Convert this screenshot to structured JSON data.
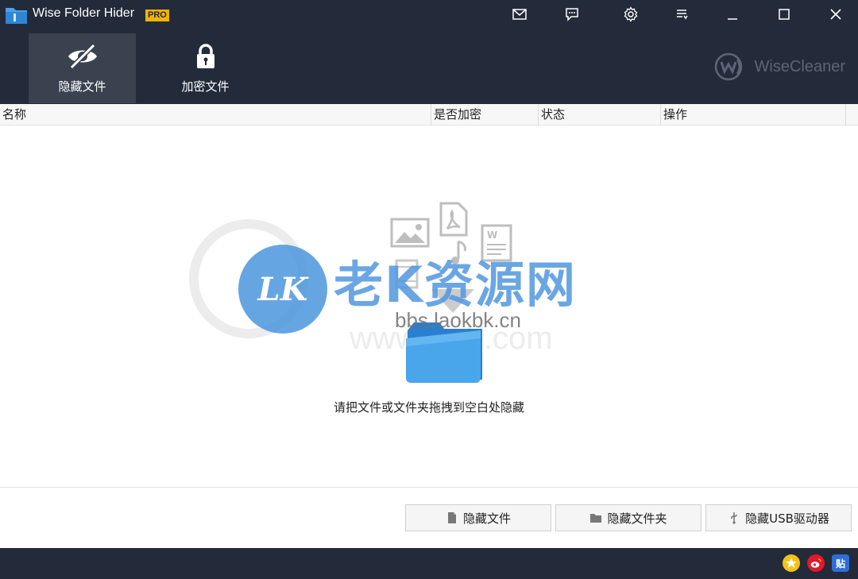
{
  "window": {
    "title": "Wise Folder Hider",
    "badge": "PRO"
  },
  "nav": {
    "tabs": [
      {
        "label": "隐藏文件",
        "icon": "eye-off-icon",
        "active": true
      },
      {
        "label": "加密文件",
        "icon": "lock-icon",
        "active": false
      }
    ],
    "brand": "WiseCleaner"
  },
  "table": {
    "columns": [
      "名称",
      "是否加密",
      "状态",
      "操作"
    ],
    "rows": []
  },
  "drop_zone": {
    "hint": "请把文件或文件夹拖拽到空白处隐藏"
  },
  "watermark": {
    "logo_text": "LK",
    "title": "老K资源网",
    "url": "bbs.laokbk.cn",
    "url2": "www.i3zh.com"
  },
  "actions": {
    "hide_file": "隐藏文件",
    "hide_folder": "隐藏文件夹",
    "hide_usb": "隐藏USB驱动器"
  },
  "statusbar": {
    "tieba_label": "贴"
  },
  "colors": {
    "chrome": "#232b3a",
    "active_tab": "#3a4250",
    "pro": "#f0b400",
    "accent_blue": "#3b8ee0"
  }
}
